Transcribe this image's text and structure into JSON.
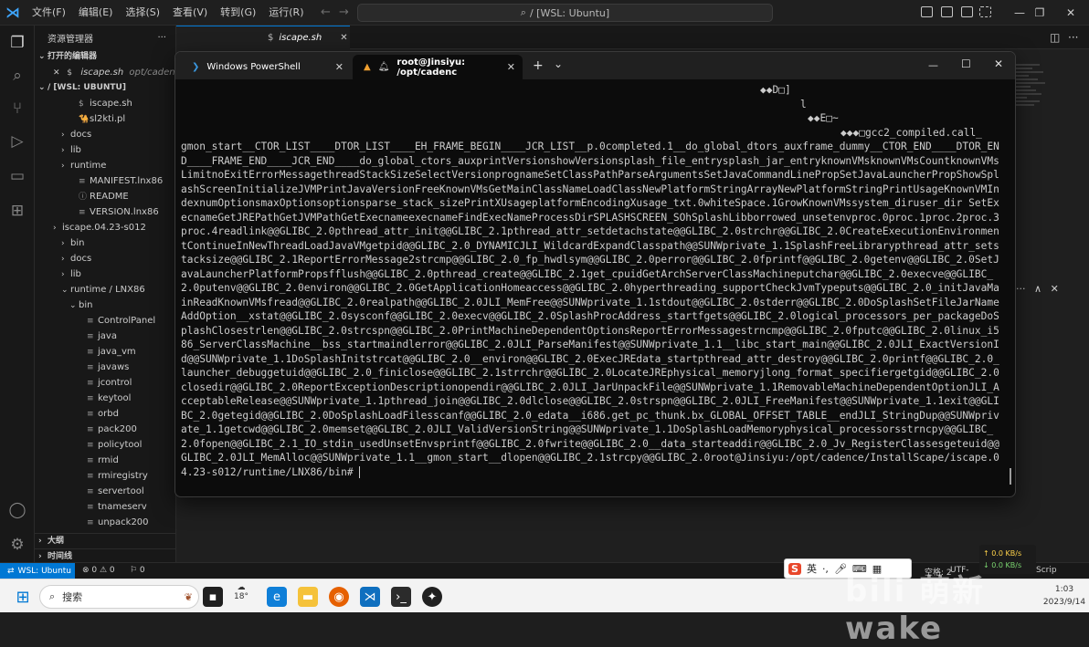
{
  "vscode": {
    "menu": [
      "文件(F)",
      "编辑(E)",
      "选择(S)",
      "查看(V)",
      "转到(G)",
      "运行(R)"
    ],
    "menu_more": "...",
    "command_center": "/ [WSL: Ubuntu]",
    "explorer_title": "资源管理器",
    "explorer_more": "···",
    "open_editors_label": "打开的编辑器",
    "open_editor_file": "iscape.sh",
    "open_editor_path": "opt/cadence/Ins",
    "workspace_label": "/ [WSL: UBUNTU]",
    "tree": [
      {
        "label": "iscape.sh",
        "indent": 2,
        "type": "file",
        "icon": "$"
      },
      {
        "label": "sl2kti.pl",
        "indent": 2,
        "type": "file",
        "icon": "🐪"
      },
      {
        "label": "docs",
        "indent": 1,
        "type": "folder"
      },
      {
        "label": "lib",
        "indent": 1,
        "type": "folder"
      },
      {
        "label": "runtime",
        "indent": 1,
        "type": "folder"
      },
      {
        "label": "MANIFEST.lnx86",
        "indent": 2,
        "type": "file",
        "icon": "≡"
      },
      {
        "label": "README",
        "indent": 2,
        "type": "file",
        "icon": "ⓘ"
      },
      {
        "label": "VERSION.lnx86",
        "indent": 2,
        "type": "file",
        "icon": "≡"
      },
      {
        "label": "iscape.04.23-s012",
        "indent": 0,
        "type": "folder"
      },
      {
        "label": "bin",
        "indent": 1,
        "type": "folder"
      },
      {
        "label": "docs",
        "indent": 1,
        "type": "folder"
      },
      {
        "label": "lib",
        "indent": 1,
        "type": "folder"
      },
      {
        "label": "runtime / LNX86",
        "indent": 1,
        "type": "folder-open"
      },
      {
        "label": "bin",
        "indent": 2,
        "type": "folder-open"
      },
      {
        "label": "ControlPanel",
        "indent": 3,
        "type": "file",
        "icon": "≡"
      },
      {
        "label": "java",
        "indent": 3,
        "type": "file",
        "icon": "≡"
      },
      {
        "label": "java_vm",
        "indent": 3,
        "type": "file",
        "icon": "≡"
      },
      {
        "label": "javaws",
        "indent": 3,
        "type": "file",
        "icon": "≡"
      },
      {
        "label": "jcontrol",
        "indent": 3,
        "type": "file",
        "icon": "≡"
      },
      {
        "label": "keytool",
        "indent": 3,
        "type": "file",
        "icon": "≡"
      },
      {
        "label": "orbd",
        "indent": 3,
        "type": "file",
        "icon": "≡"
      },
      {
        "label": "pack200",
        "indent": 3,
        "type": "file",
        "icon": "≡"
      },
      {
        "label": "policytool",
        "indent": 3,
        "type": "file",
        "icon": "≡"
      },
      {
        "label": "rmid",
        "indent": 3,
        "type": "file",
        "icon": "≡"
      },
      {
        "label": "rmiregistry",
        "indent": 3,
        "type": "file",
        "icon": "≡"
      },
      {
        "label": "servertool",
        "indent": 3,
        "type": "file",
        "icon": "≡"
      },
      {
        "label": "tnameserv",
        "indent": 3,
        "type": "file",
        "icon": "≡"
      },
      {
        "label": "unpack200",
        "indent": 3,
        "type": "file",
        "icon": "≡"
      }
    ],
    "outline_label": "大纲",
    "timeline_label": "时间线",
    "editor_tab": "iscape.sh",
    "status": {
      "remote": "WSL: Ubuntu",
      "problems": "⊗ 0  ⚠ 0",
      "ports": "⚐ 0",
      "right_1": "空格: 2",
      "right_2": "UTF-",
      "right_3": "Scrip"
    }
  },
  "terminal": {
    "tab1_label": "Windows PowerShell",
    "tab2_label": "root@Jinsiyu: /opt/cadenc",
    "new_tab": "+",
    "dropdown": "⌄",
    "minimize": "—",
    "maximize": "☐",
    "close": "✕",
    "output_head": [
      "◆◆D□]",
      "l",
      "◆◆E□~",
      "◆◆◆□gcc2_compiled.call_"
    ],
    "output_body": "gmon_start__CTOR_LIST____DTOR_LIST____EH_FRAME_BEGIN____JCR_LIST__p.0completed.1__do_global_dtors_auxframe_dummy__CTOR_END____DTOR_END____FRAME_END____JCR_END____do_global_ctors_auxprintVersionshowVersionsplash_file_entrysplash_jar_entryknownVMsknownVMsCountknownVMsLimitnoExitErrorMessagethreadStackSizeSelectVersionprognameSetClassPathParseArgumentsSetJavaCommandLinePropSetJavaLauncherPropShowSplashScreenInitializeJVMPrintJavaVersionFreeKnownVMsGetMainClassNameLoadClassNewPlatformStringArrayNewPlatformStringPrintUsageKnownVMIndexnumOptionsmaxOptionsoptionsparse_stack_sizePrintXUsageplatformEncodingXusage_txt.0whiteSpace.1GrowKnownVMssystem_diruser_dir SetExecnameGetJREPathGetJVMPathGetExecnameexecnameFindExecNameProcessDirSPLASHSCREEN_SOhSplashLibborrowed_unsetenvproc.0proc.1proc.2proc.3proc.4readlink@@GLIBC_2.0pthread_attr_init@@GLIBC_2.1pthread_attr_setdetachstate@@GLIBC_2.0strchr@@GLIBC_2.0CreateExecutionEnvironmentContinueInNewThreadLoadJavaVMgetpid@@GLIBC_2.0_DYNAMICJLI_WildcardExpandClasspath@@SUNWprivate_1.1SplashFreeLibrarypthread_attr_setstacksize@@GLIBC_2.1ReportErrorMessage2strcmp@@GLIBC_2.0_fp_hwdlsym@@GLIBC_2.0perror@@GLIBC_2.0fprintf@@GLIBC_2.0getenv@@GLIBC_2.0SetJavaLauncherPlatformPropsfflush@@GLIBC_2.0pthread_create@@GLIBC_2.1get_cpuidGetArchServerClassMachineputchar@@GLIBC_2.0execve@@GLIBC_2.0putenv@@GLIBC_2.0environ@@GLIBC_2.0GetApplicationHomeaccess@@GLIBC_2.0hyperthreading_supportCheckJvmTypeputs@@GLIBC_2.0_initJavaMainReadKnownVMsfread@@GLIBC_2.0realpath@@GLIBC_2.0JLI_MemFree@@SUNWprivate_1.1stdout@@GLIBC_2.0stderr@@GLIBC_2.0DoSplashSetFileJarNameAddOption__xstat@@GLIBC_2.0sysconf@@GLIBC_2.0execv@@GLIBC_2.0SplashProcAddress_startfgets@@GLIBC_2.0logical_processors_per_packageDoSplashClosestrlen@@GLIBC_2.0strcspn@@GLIBC_2.0PrintMachineDependentOptionsReportErrorMessagestrncmp@@GLIBC_2.0fputc@@GLIBC_2.0linux_i586_ServerClassMachine__bss_startmaindlerror@@GLIBC_2.0JLI_ParseManifest@@SUNWprivate_1.1__libc_start_main@@GLIBC_2.0JLI_ExactVersionId@@SUNWprivate_1.1DoSplashInitstrcat@@GLIBC_2.0__environ@@GLIBC_2.0ExecJREdata_startpthread_attr_destroy@@GLIBC_2.0printf@@GLIBC_2.0_launcher_debuggetuid@@GLIBC_2.0_finiclose@@GLIBC_2.1strrchr@@GLIBC_2.0LocateJREphysical_memoryjlong_format_specifiergetgid@@GLIBC_2.0closedir@@GLIBC_2.0ReportExceptionDescriptionopendir@@GLIBC_2.0JLI_JarUnpackFile@@SUNWprivate_1.1RemovableMachineDependentOptionJLI_AcceptableRelease@@SUNWprivate_1.1pthread_join@@GLIBC_2.0dlclose@@GLIBC_2.0strspn@@GLIBC_2.0JLI_FreeManifest@@SUNWprivate_1.1exit@@GLIBC_2.0getegid@@GLIBC_2.0DoSplashLoadFilesscanf@@GLIBC_2.0_edata__i686.get_pc_thunk.bx_GLOBAL_OFFSET_TABLE__endJLI_StringDup@@SUNWprivate_1.1getcwd@@GLIBC_2.0memset@@GLIBC_2.0JLI_ValidVersionString@@SUNWprivate_1.1DoSplashLoadMemoryphysical_processorsstrncpy@@GLIBC_2.0fopen@@GLIBC_2.1_IO_stdin_usedUnsetEnvsprintf@@GLIBC_2.0fwrite@@GLIBC_2.0__data_starteaddir@@GLIBC_2.0_Jv_RegisterClassesgeteuid@@GLIBC_2.0JLI_MemAlloc@@SUNWprivate_1.1__gmon_start__dlopen@@GLIBC_2.1strcpy@@GLIBC_2.0",
    "prompt": "root@Jinsiyu:/opt/cadence/InstallScape/iscape.04.23-s012/runtime/LNX86/bin# "
  },
  "taskbar": {
    "search_placeholder": "搜索",
    "weather_temp": "18°",
    "clock_time": "1:03",
    "clock_date": "2023/9/14"
  },
  "ime": {
    "label": "英",
    "punct": "·,"
  },
  "netspeed": {
    "up": "↑ 0.0 KB/s",
    "down": "↓ 0.0 KB/s"
  },
  "watermark": "bili 萌新wake",
  "colors": {
    "accent": "#0078d4",
    "terminal_bg": "#0c0c0c",
    "status_remote": "#0078d4"
  }
}
